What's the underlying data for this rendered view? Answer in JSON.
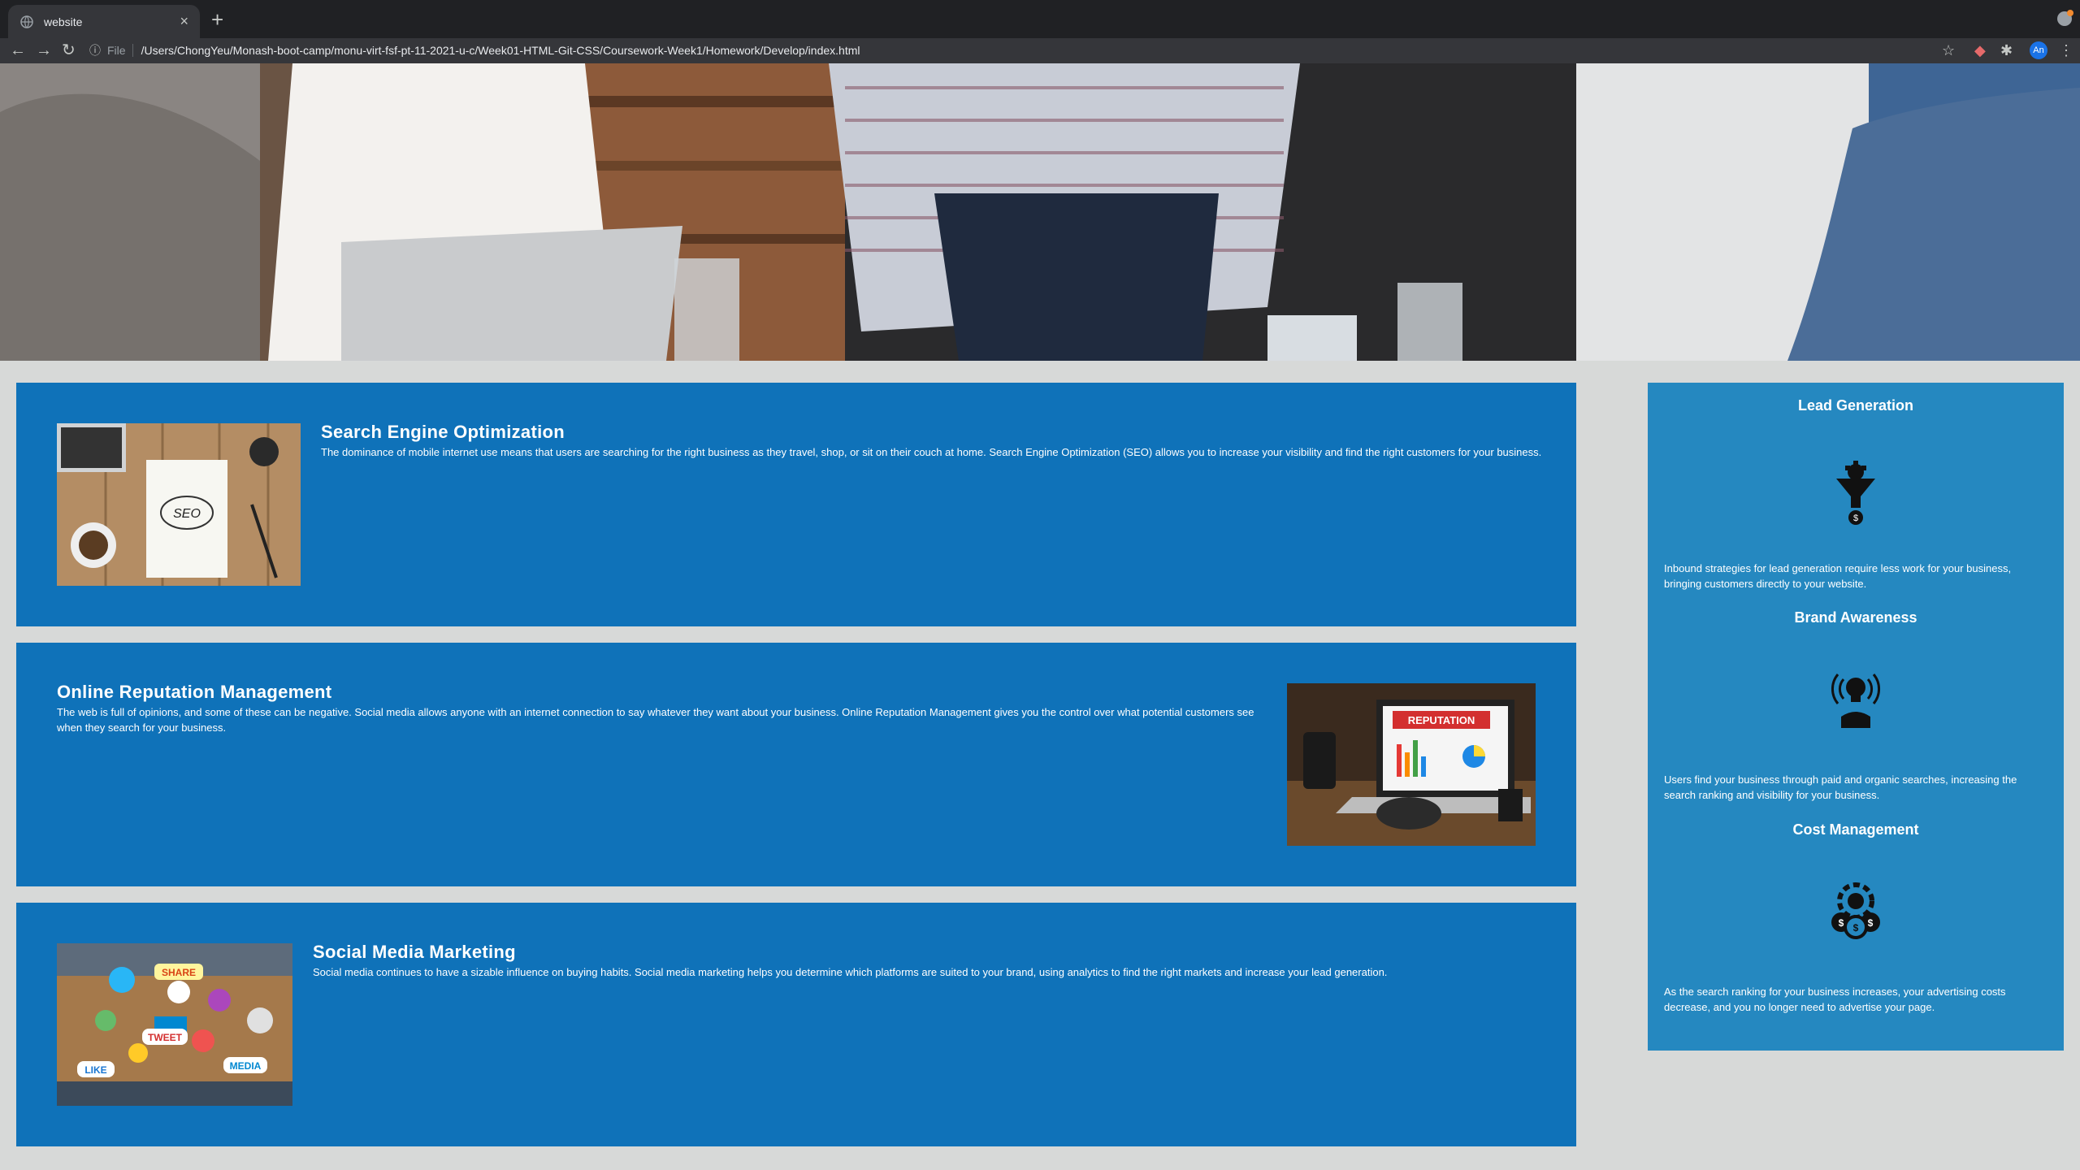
{
  "browser": {
    "tab_title": "website",
    "scheme_label": "File",
    "url": "/Users/ChongYeu/Monash-boot-camp/monu-virt-fsf-pt-11-2021-u-c/Week01-HTML-Git-CSS/Coursework-Week1/Homework/Develop/index.html",
    "profile_initials": "An"
  },
  "content": [
    {
      "heading": "Search Engine Optimization",
      "text": "The dominance of mobile internet use means that users are searching for the right business as they travel, shop, or sit on their couch at home. Search Engine Optimization (SEO) allows you to increase your visibility and find the right customers for your business.",
      "image_label": "SEO"
    },
    {
      "heading": "Online Reputation Management",
      "text": "The web is full of opinions, and some of these can be negative. Social media allows anyone with an internet connection to say whatever they want about your business. Online Reputation Management gives you the control over what potential customers see when they search for your business.",
      "image_label": "REPUTATION"
    },
    {
      "heading": "Social Media Marketing",
      "text": "Social media continues to have a sizable influence on buying habits. Social media marketing helps you determine which platforms are suited to your brand, using analytics to find the right markets and increase your lead generation.",
      "image_labels": [
        "SHARE",
        "TWEET",
        "LIKE",
        "MEDIA"
      ]
    }
  ],
  "benefits": [
    {
      "heading": "Lead Generation",
      "text": "Inbound strategies for lead generation require less work for your business, bringing customers directly to your website.",
      "icon": "lead-funnel-icon"
    },
    {
      "heading": "Brand Awareness",
      "text": "Users find your business through paid and organic searches, increasing the search ranking and visibility for your business.",
      "icon": "lightbulb-broadcast-icon"
    },
    {
      "heading": "Cost Management",
      "text": "As the search ranking for your business increases, your advertising costs decrease, and you no longer need to advertise your page.",
      "icon": "coins-gear-icon"
    }
  ],
  "colors": {
    "content_bg": "#0f72b9",
    "benefits_bg": "#2588c0",
    "page_bg": "#d7d9d8"
  }
}
